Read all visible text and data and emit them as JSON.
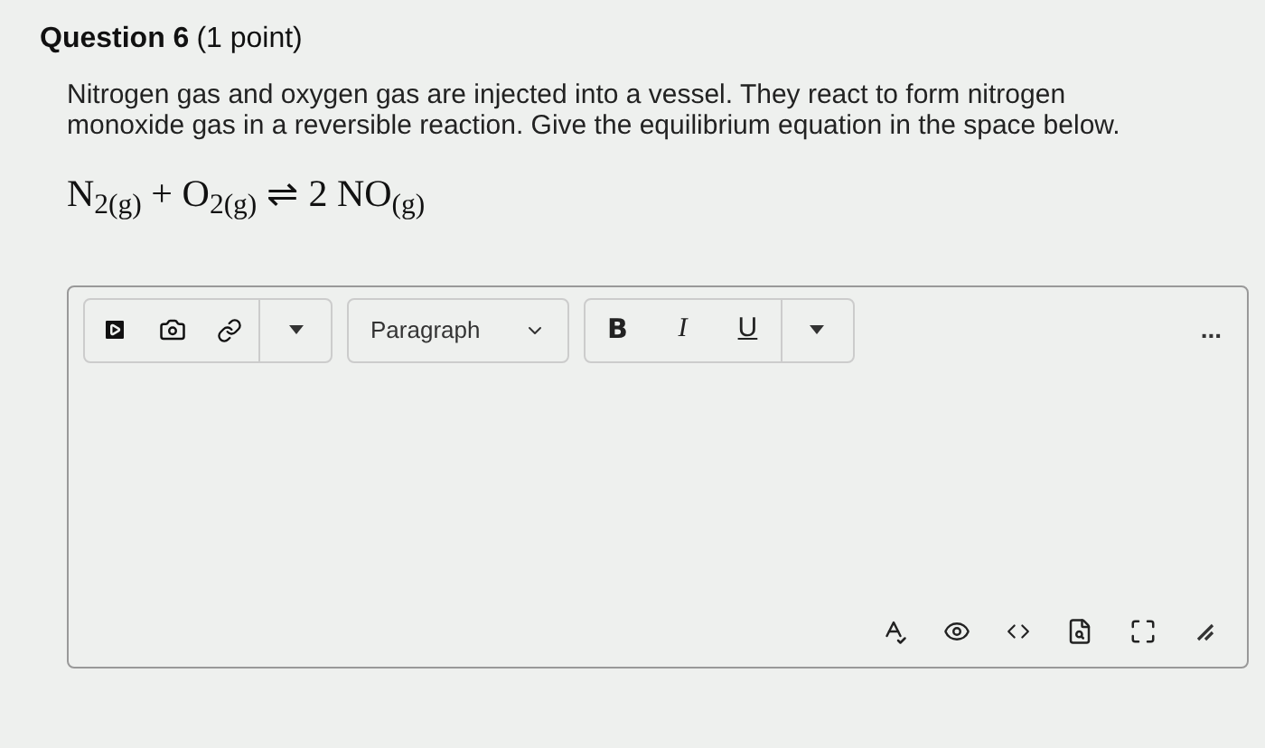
{
  "question": {
    "title": "Question 6",
    "points": "(1 point)"
  },
  "prompt": "Nitrogen gas and oxygen gas are injected into a vessel. They react to form nitrogen monoxide gas in a reversible reaction. Give the equilibrium equation in the space below.",
  "equation": "N$_{2(g)}$ + O$_{2(g)}$ ⇌ 2 NO$_{(g)}$",
  "editor": {
    "block_format": "Paragraph",
    "format_buttons": [
      {
        "kind": "bold",
        "label": "B"
      },
      {
        "kind": "italic",
        "label": "I"
      },
      {
        "kind": "underline",
        "label": "U"
      }
    ],
    "more": "..."
  }
}
